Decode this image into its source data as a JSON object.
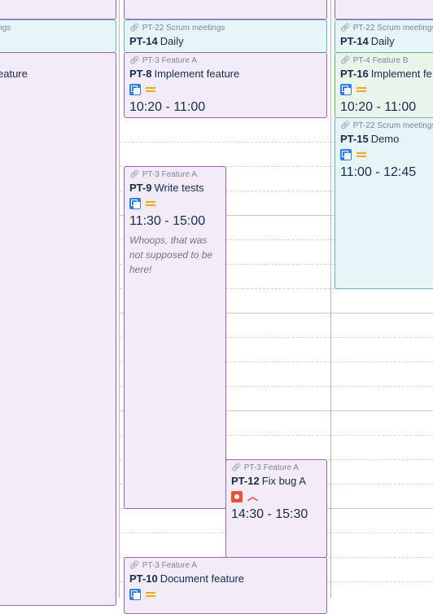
{
  "events": {
    "left_partial_top": {},
    "left_partial_meetings": {
      "epic": "ngs"
    },
    "left_partial_feature": {
      "title": "eature"
    },
    "col1_top": {},
    "col1_daily": {
      "epic": "PT-22 Scrum meetings",
      "key": "PT-14",
      "summary": "Daily"
    },
    "col1_implement": {
      "epic": "PT-3 Feature A",
      "key": "PT-8",
      "summary": "Implement feature",
      "type_icon": "story-icon",
      "priority_icon": "priority-medium-icon",
      "time": "10:20 - 11:00"
    },
    "col1_tests": {
      "epic": "PT-3 Feature A",
      "key": "PT-9",
      "summary": "Write tests",
      "type_icon": "story-icon",
      "priority_icon": "priority-medium-icon",
      "time": "11:30 - 15:00",
      "note": "Whoops, that was not supposed to be here!"
    },
    "col1_fixbug": {
      "epic": "PT-3 Feature A",
      "key": "PT-12",
      "summary": "Fix bug A",
      "type_icon": "bug-icon",
      "priority_icon": "priority-high-icon",
      "time": "14:30 - 15:30"
    },
    "col1_document": {
      "epic": "PT-3 Feature A",
      "key": "PT-10",
      "summary": "Document feature",
      "type_icon": "story-icon",
      "priority_icon": "priority-medium-icon"
    },
    "col2_top": {},
    "col2_daily": {
      "epic": "PT-22 Scrum meetings",
      "key": "PT-14",
      "summary": "Daily"
    },
    "col2_implement": {
      "epic": "PT-4 Feature B",
      "key": "PT-16",
      "summary": "Implement fe",
      "type_icon": "story-icon",
      "priority_icon": "priority-medium-icon",
      "time": "10:20 - 11:00"
    },
    "col2_demo": {
      "epic": "PT-22 Scrum meetings",
      "key": "PT-15",
      "summary": "Demo",
      "type_icon": "story-icon",
      "priority_icon": "priority-medium-icon",
      "time": "11:00 - 12:45"
    }
  },
  "colors": {
    "purple_bg": "#f4ebf8",
    "purple_border": "#9b64b3",
    "cyan_bg": "#e6f6f8",
    "green_bg": "#e9f5ea",
    "story_blue": "#2f7fe6",
    "bug_red": "#e8503a",
    "priority_orange": "#f5a623"
  }
}
